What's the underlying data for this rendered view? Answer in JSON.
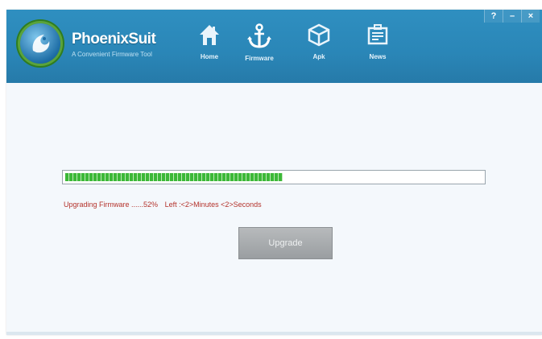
{
  "app": {
    "name": "PhoenixSuit",
    "subtitle": "A Convenient Firmware Tool"
  },
  "nav": [
    {
      "label": "Home",
      "icon": "home-icon"
    },
    {
      "label": "Firmware",
      "icon": "anchor-icon"
    },
    {
      "label": "Apk",
      "icon": "package-icon"
    },
    {
      "label": "News",
      "icon": "news-icon"
    }
  ],
  "window_controls": {
    "help": "?",
    "minimize": "–",
    "close": "×"
  },
  "progress": {
    "percent": 52,
    "fill_color": "#3cb838"
  },
  "status": {
    "action": "Upgrading Firmware ......52%",
    "remaining": "Left :<2>Minutes <2>Seconds"
  },
  "upgrade_button": {
    "label": "Upgrade"
  },
  "colors": {
    "header": "#2a86b7",
    "status_text": "#b4322b",
    "progress_green": "#3cb838"
  }
}
